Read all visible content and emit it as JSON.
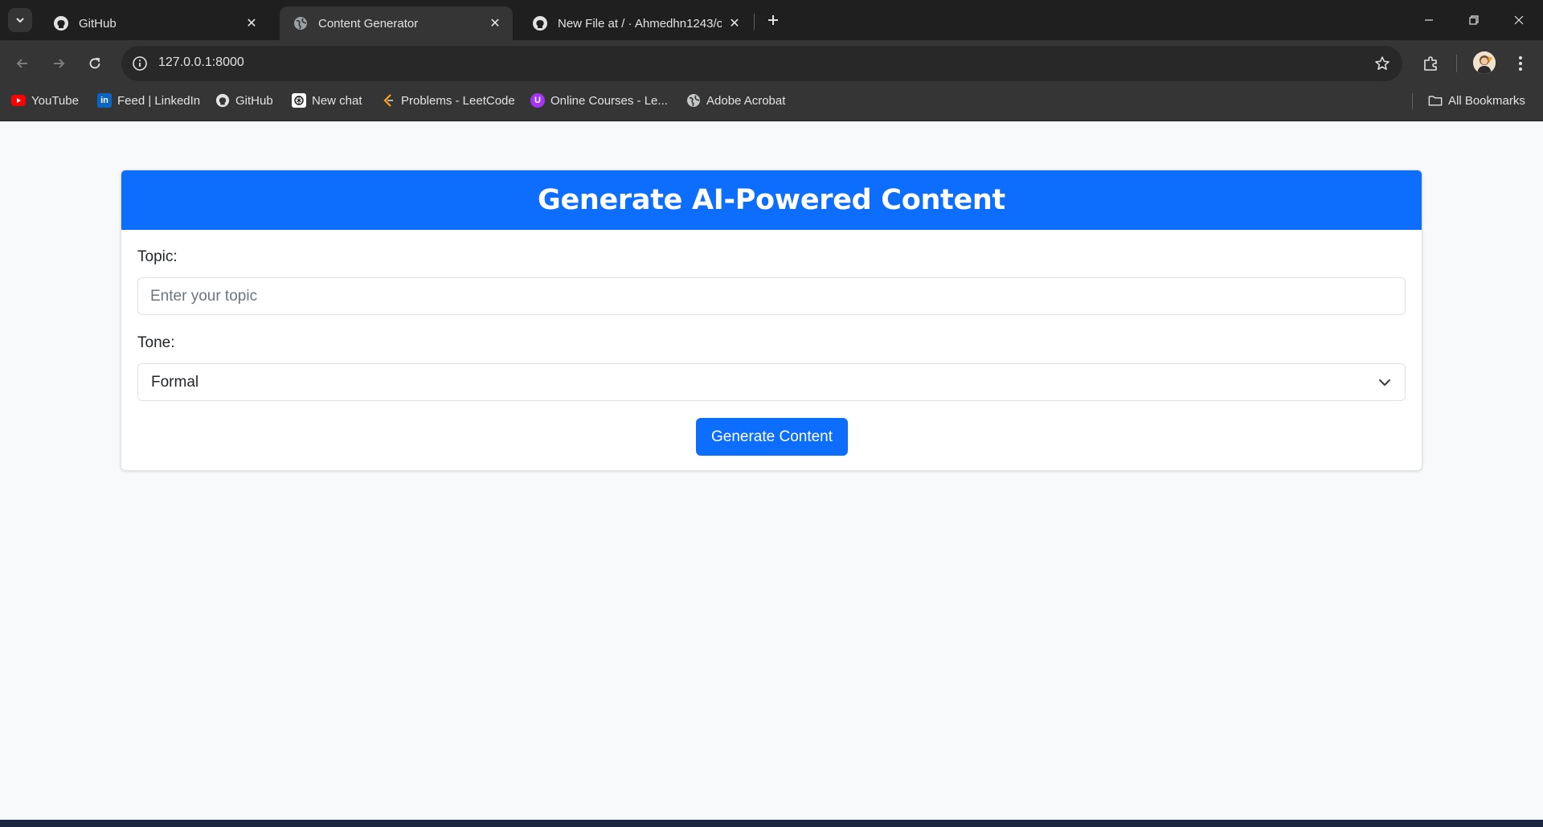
{
  "browser": {
    "tabs": [
      {
        "title": "GitHub",
        "icon": "github-icon",
        "active": false
      },
      {
        "title": "Content Generator",
        "icon": "globe-icon",
        "active": true
      },
      {
        "title": "New File at / · Ahmedhn1243/c",
        "icon": "github-icon",
        "active": false
      }
    ],
    "address": "127.0.0.1:8000",
    "bookmarks": [
      {
        "label": "YouTube",
        "icon": "youtube-icon",
        "color": "#ff0000"
      },
      {
        "label": "Feed | LinkedIn",
        "icon": "linkedin-icon",
        "color": "#0a66c2"
      },
      {
        "label": "GitHub",
        "icon": "github-icon",
        "color": "#ffffff"
      },
      {
        "label": "New chat",
        "icon": "chatgpt-icon",
        "color": "#ffffff"
      },
      {
        "label": "Problems - LeetCode",
        "icon": "leetcode-icon",
        "color": "#ffa116"
      },
      {
        "label": "Online Courses - Le...",
        "icon": "udemy-icon",
        "color": "#a435f0"
      },
      {
        "label": "Adobe Acrobat",
        "icon": "globe-icon",
        "color": "#e3e3e3"
      }
    ],
    "all_bookmarks": "All Bookmarks"
  },
  "page": {
    "title": "Generate AI-Powered Content",
    "topic_label": "Topic:",
    "topic_placeholder": "Enter your topic",
    "tone_label": "Tone:",
    "tone_value": "Formal",
    "submit_label": "Generate Content",
    "accent_color": "#0d6efd"
  }
}
